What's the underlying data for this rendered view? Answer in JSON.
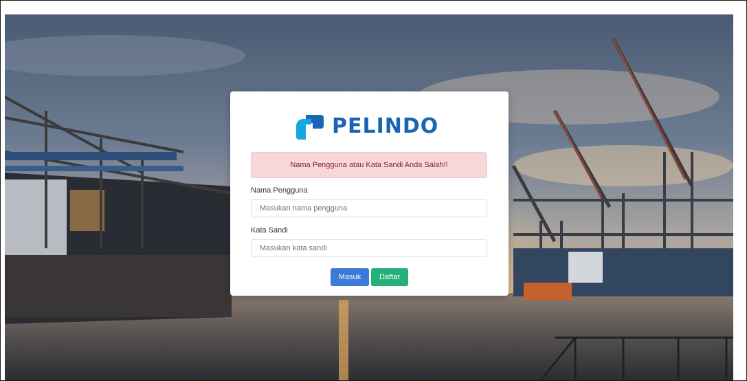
{
  "brand": {
    "name": "PELINDO",
    "logo_colors": {
      "primary": "#1a66b4",
      "secondary": "#16a6e0"
    }
  },
  "alert": {
    "message": "Nama Pengguna atau Kata Sandi Anda Salah!!",
    "color": "#842029",
    "background": "#f8d7da"
  },
  "form": {
    "username": {
      "label": "Nama Pengguna",
      "placeholder": "Masukan nama pengguna",
      "value": ""
    },
    "password": {
      "label": "Kata Sandi",
      "placeholder": "Masukan kata sandi",
      "value": ""
    },
    "submit_label": "Masuk",
    "register_label": "Daftar"
  },
  "colors": {
    "submit_button": "#3a7ad8",
    "register_button": "#23b07a"
  }
}
